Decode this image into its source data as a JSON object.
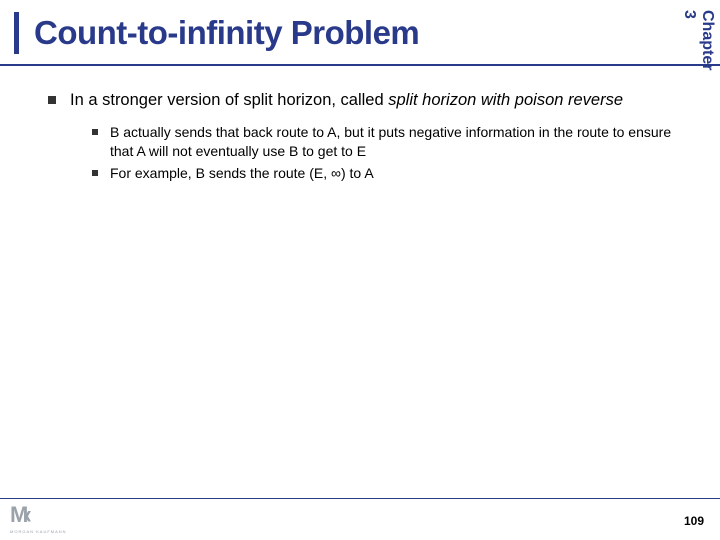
{
  "header": {
    "title": "Count-to-infinity Problem",
    "chapter": "Chapter 3"
  },
  "content": {
    "main_bullet": {
      "prefix": "In a stronger version of split horizon, called ",
      "italic": "split horizon with poison reverse"
    },
    "sub_bullets": [
      "B actually sends that back route to A, but it puts negative information in the route to ensure that A will not eventually use B to get to E",
      "For example, B sends the route (E, ∞) to A"
    ]
  },
  "footer": {
    "logo_main": "M",
    "logo_chevron": "‹",
    "logo_sub": "MORGAN KAUFMANN",
    "page": "109"
  }
}
